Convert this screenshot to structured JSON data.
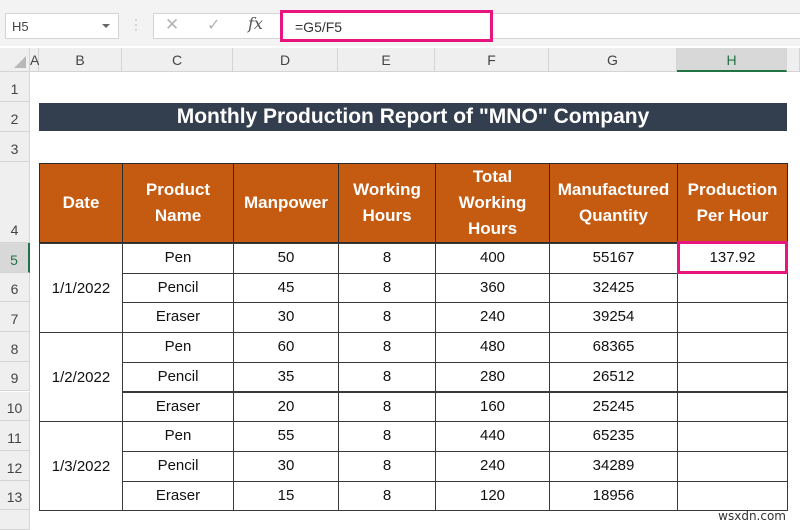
{
  "formula_bar": {
    "name_box": "H5",
    "cancel_icon": "✕",
    "enter_icon": "✓",
    "fx_label": "fx",
    "formula": "=G5/F5",
    "highlight_color": "#e8157f"
  },
  "columns": [
    "A",
    "B",
    "C",
    "D",
    "E",
    "F",
    "G",
    "H"
  ],
  "selected_column": "H",
  "rows": [
    "1",
    "2",
    "3",
    "4",
    "5",
    "6",
    "7",
    "8",
    "9",
    "10",
    "11",
    "12",
    "13"
  ],
  "selected_row": "5",
  "report": {
    "title": "Monthly Production Report of \"MNO\" Company",
    "title_bg": "#333f4f",
    "header_bg": "#c55a11",
    "headers": [
      "Date",
      "Product Name",
      "Manpower",
      "Working Hours",
      "Total Working Hours",
      "Manufactured Quantity",
      "Production Per Hour"
    ],
    "groups": [
      {
        "date": "1/1/2022",
        "items": [
          {
            "product": "Pen",
            "manpower": "50",
            "hours": "8",
            "total_hours": "400",
            "quantity": "55167",
            "per_hour": "137.92"
          },
          {
            "product": "Pencil",
            "manpower": "45",
            "hours": "8",
            "total_hours": "360",
            "quantity": "32425",
            "per_hour": ""
          },
          {
            "product": "Eraser",
            "manpower": "30",
            "hours": "8",
            "total_hours": "240",
            "quantity": "39254",
            "per_hour": ""
          }
        ]
      },
      {
        "date": "1/2/2022",
        "items": [
          {
            "product": "Pen",
            "manpower": "60",
            "hours": "8",
            "total_hours": "480",
            "quantity": "68365",
            "per_hour": ""
          },
          {
            "product": "Pencil",
            "manpower": "35",
            "hours": "8",
            "total_hours": "280",
            "quantity": "26512",
            "per_hour": ""
          },
          {
            "product": "Eraser",
            "manpower": "20",
            "hours": "8",
            "total_hours": "160",
            "quantity": "25245",
            "per_hour": ""
          }
        ]
      },
      {
        "date": "1/3/2022",
        "items": [
          {
            "product": "Pen",
            "manpower": "55",
            "hours": "8",
            "total_hours": "440",
            "quantity": "65235",
            "per_hour": ""
          },
          {
            "product": "Pencil",
            "manpower": "30",
            "hours": "8",
            "total_hours": "240",
            "quantity": "34289",
            "per_hour": ""
          },
          {
            "product": "Eraser",
            "manpower": "15",
            "hours": "8",
            "total_hours": "120",
            "quantity": "18956",
            "per_hour": ""
          }
        ]
      }
    ]
  },
  "watermark": "wsxdn.com"
}
